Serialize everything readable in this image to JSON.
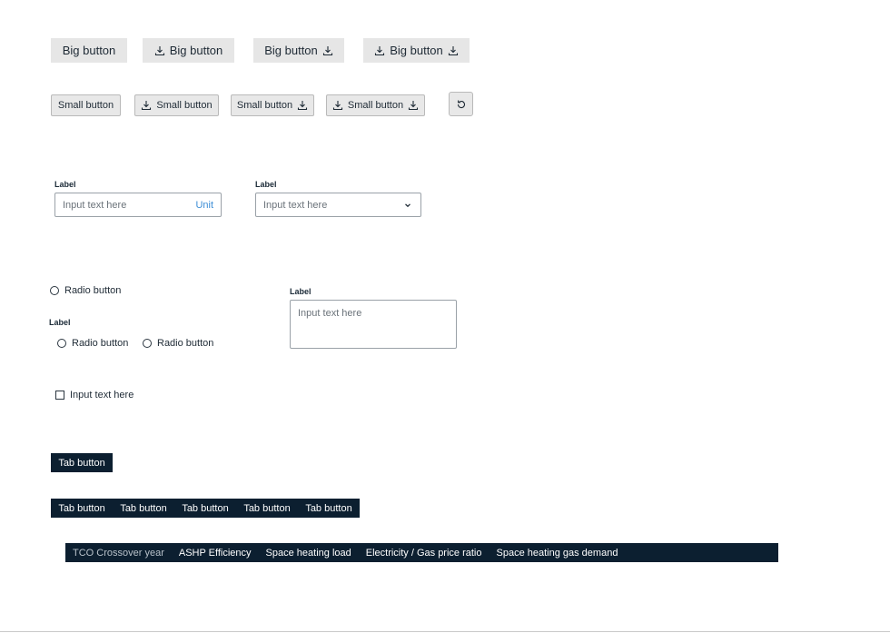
{
  "big_buttons": [
    {
      "label": "Big button",
      "icon_left": null,
      "icon_right": null
    },
    {
      "label": "Big button",
      "icon_left": "download-icon",
      "icon_right": null
    },
    {
      "label": "Big button",
      "icon_left": null,
      "icon_right": "download-icon"
    },
    {
      "label": "Big button",
      "icon_left": "download-icon",
      "icon_right": "download-icon"
    }
  ],
  "small_buttons": [
    {
      "label": "Small button",
      "icon_left": null,
      "icon_right": null
    },
    {
      "label": "Small button",
      "icon_left": "download-icon",
      "icon_right": null
    },
    {
      "label": "Small button",
      "icon_left": null,
      "icon_right": "download-icon"
    },
    {
      "label": "Small button",
      "icon_left": "download-icon",
      "icon_right": "download-icon"
    }
  ],
  "refresh_button": {
    "icon": "refresh-icon"
  },
  "unit_input": {
    "label": "Label",
    "placeholder": "Input text here",
    "unit": "Unit"
  },
  "select_input": {
    "label": "Label",
    "placeholder": "Input text here",
    "icon": "chevron-down-icon"
  },
  "radio_single": {
    "label": "Radio button"
  },
  "radio_group": {
    "label": "Label",
    "options": [
      "Radio button",
      "Radio button"
    ]
  },
  "textarea": {
    "label": "Label",
    "placeholder": "Input text here"
  },
  "checkbox": {
    "label": "Input text here"
  },
  "tab_single": {
    "label": "Tab button"
  },
  "tab_bar": {
    "tabs": [
      "Tab button",
      "Tab button",
      "Tab button",
      "Tab button",
      "Tab button"
    ]
  },
  "metric_tabs": {
    "active_index": 0,
    "tabs": [
      "TCO Crossover year",
      "ASHP Efficiency",
      "Space heating load",
      "Electricity / Gas price ratio",
      "Space heating gas demand"
    ]
  },
  "colors": {
    "tab_bg": "#0c1f30",
    "button_bg": "#e6e6e6",
    "unit_accent": "#3d8ed6"
  }
}
